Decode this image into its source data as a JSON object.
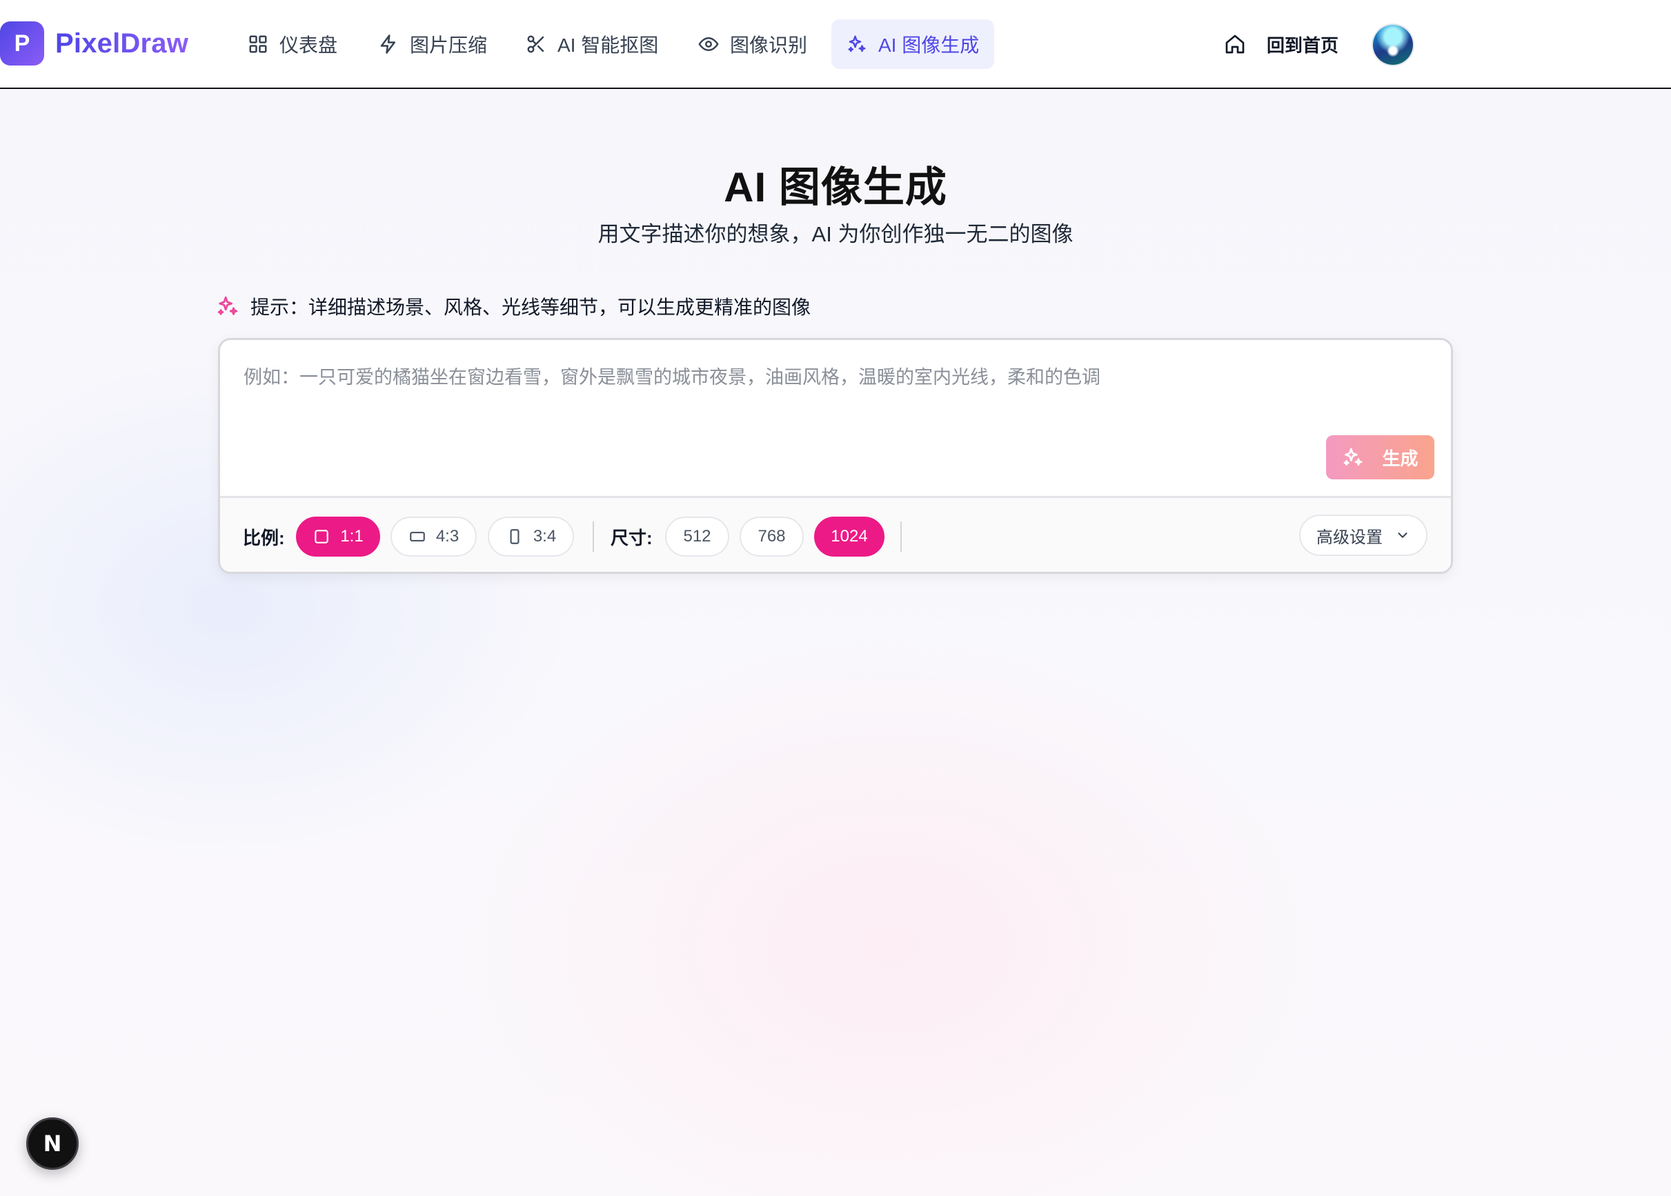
{
  "brand": {
    "logo_letter": "P",
    "name": "PixelDraw"
  },
  "nav": {
    "items": [
      {
        "label": "仪表盘",
        "icon": "grid-icon"
      },
      {
        "label": "图片压缩",
        "icon": "lightning-icon"
      },
      {
        "label": "AI 智能抠图",
        "icon": "scissors-icon"
      },
      {
        "label": "图像识别",
        "icon": "eye-icon"
      },
      {
        "label": "AI 图像生成",
        "icon": "sparkles-icon",
        "active": true
      }
    ],
    "home_label": "回到首页"
  },
  "hero": {
    "title": "AI 图像生成",
    "subtitle": "用文字描述你的想象，AI 为你创作独一无二的图像"
  },
  "tip": {
    "text": "提示：详细描述场景、风格、光线等细节，可以生成更精准的图像"
  },
  "prompt": {
    "value": "",
    "placeholder": "例如：一只可爱的橘猫坐在窗边看雪，窗外是飘雪的城市夜景，油画风格，温暖的室内光线，柔和的色调",
    "generate_label": "生成"
  },
  "options": {
    "ratio_label": "比例:",
    "ratios": [
      {
        "label": "1:1",
        "selected": true
      },
      {
        "label": "4:3",
        "selected": false
      },
      {
        "label": "3:4",
        "selected": false
      }
    ],
    "size_label": "尺寸:",
    "sizes": [
      {
        "label": "512",
        "selected": false
      },
      {
        "label": "768",
        "selected": false
      },
      {
        "label": "1024",
        "selected": true
      }
    ],
    "advanced_label": "高级设置"
  },
  "dev_badge": {
    "letter": "N"
  },
  "colors": {
    "primary": "#4f46e5",
    "accent_pink": "#ec1a87",
    "generate_gradient_start": "#f49ac1",
    "generate_gradient_end": "#f9a48c"
  }
}
